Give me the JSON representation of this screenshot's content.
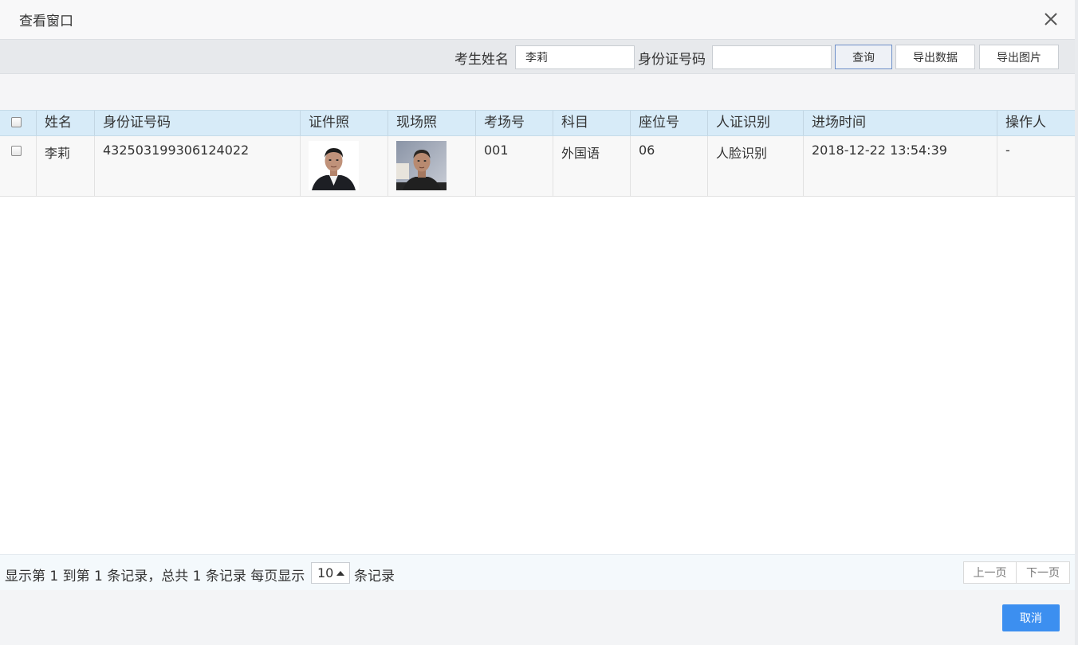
{
  "window": {
    "title": "查看窗口"
  },
  "search": {
    "name_label": "考生姓名",
    "name_value": "李莉",
    "id_label": "身份证号码",
    "id_value": "",
    "query_button": "查询",
    "export_data_button": "导出数据",
    "export_image_button": "导出图片"
  },
  "table": {
    "headers": [
      "姓名",
      "身份证号码",
      "证件照",
      "现场照",
      "考场号",
      "科目",
      "座位号",
      "人证识别",
      "进场时间",
      "操作人"
    ],
    "rows": [
      {
        "name": "李莉",
        "id_number": "432503199306124022",
        "exam_room": "001",
        "subject": "外国语",
        "seat": "06",
        "verification": "人脸识别",
        "entry_time": "2018-12-22 13:54:39",
        "operator": "-"
      }
    ]
  },
  "pager": {
    "summary": "显示第 1 到第 1 条记录，总共 1 条记录 每页显示",
    "page_size": "10",
    "suffix": "条记录",
    "prev": "上一页",
    "next": "下一页"
  },
  "footer": {
    "cancel_button": "取消"
  },
  "colors": {
    "accent": "#3c8ff0",
    "header_bg": "#d7ebf8",
    "toolbar_bg": "#e7e9ec"
  }
}
